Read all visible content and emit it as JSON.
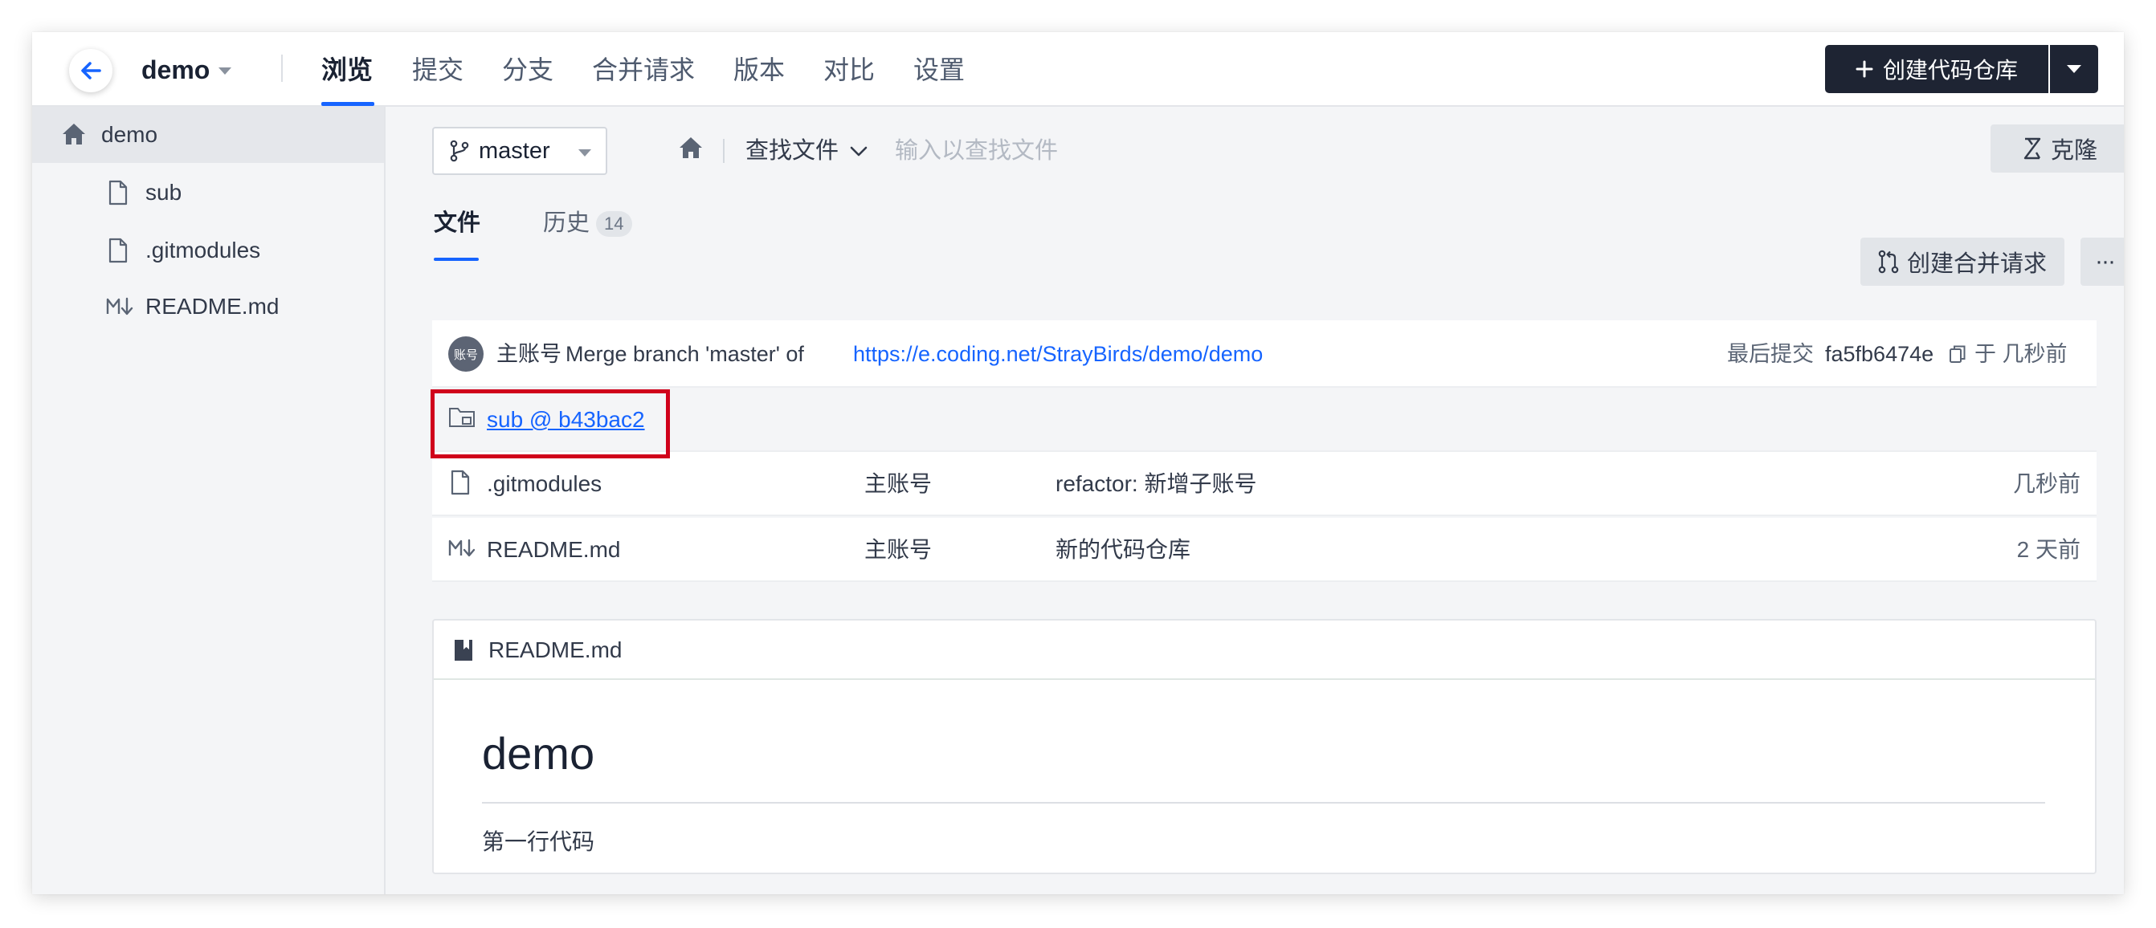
{
  "header": {
    "repo_name": "demo",
    "nav_tabs": [
      "浏览",
      "提交",
      "分支",
      "合并请求",
      "版本",
      "对比",
      "设置"
    ],
    "active_tab": "浏览",
    "create_repo_label": "创建代码仓库"
  },
  "sidebar": {
    "root": "demo",
    "items": [
      {
        "label": "sub",
        "icon": "file-icon"
      },
      {
        "label": ".gitmodules",
        "icon": "file-icon"
      },
      {
        "label": "README.md",
        "icon": "markdown-icon"
      }
    ]
  },
  "toolbar": {
    "branch": "master",
    "find_file_label": "查找文件",
    "find_file_placeholder": "输入以查找文件",
    "clone_label": "克隆"
  },
  "tabs": {
    "files_label": "文件",
    "history_label": "历史",
    "history_count": "14",
    "create_mr_label": "创建合并请求",
    "more_label": "···"
  },
  "commit": {
    "avatar_text": "账号",
    "author": "主账号",
    "message": "Merge branch 'master' of",
    "link": "https://e.coding.net/StrayBirds/demo/demo",
    "last_commit_label": "最后提交",
    "hash": "fa5fb6474e",
    "time": "于 几秒前"
  },
  "files": [
    {
      "name": "sub @ b43bac2",
      "type": "submodule",
      "author": "",
      "message": "",
      "time": "",
      "highlighted": true
    },
    {
      "name": ".gitmodules",
      "type": "file",
      "author": "主账号",
      "message": "refactor: 新增子账号",
      "time": "几秒前"
    },
    {
      "name": "README.md",
      "type": "markdown",
      "author": "主账号",
      "message": "新的代码仓库",
      "time": "2 天前"
    }
  ],
  "readme": {
    "filename": "README.md",
    "heading": "demo",
    "paragraph": "第一行代码"
  },
  "colors": {
    "accent": "#1664ff",
    "dark_button": "#1e2433",
    "highlight": "#d0021b"
  }
}
